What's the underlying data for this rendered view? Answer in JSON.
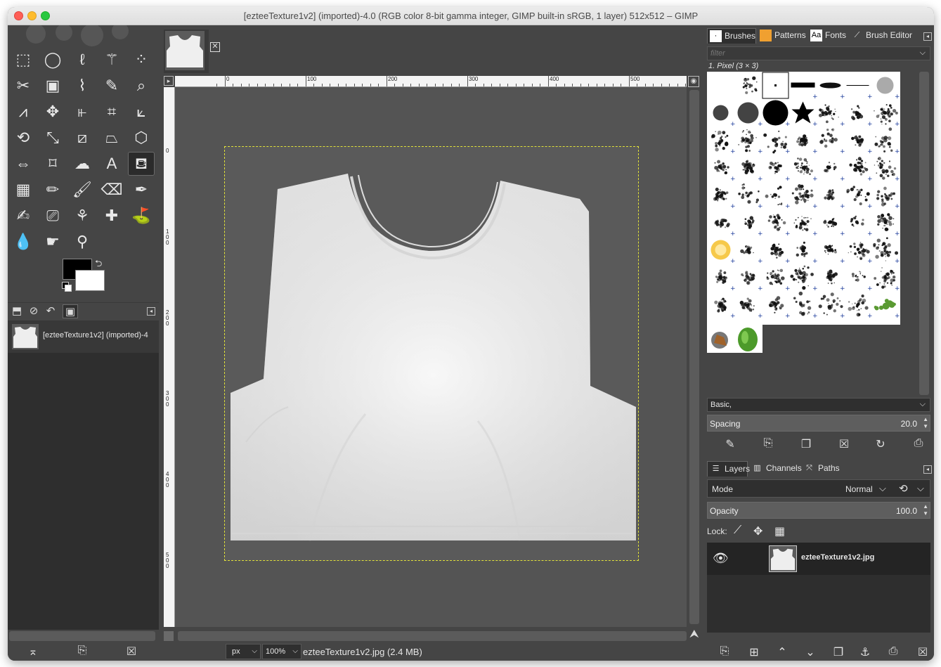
{
  "window": {
    "title": "[ezteeTexture1v2] (imported)-4.0 (RGB color 8-bit gamma integer, GIMP built-in sRGB, 1 layer) 512x512 – GIMP"
  },
  "toolbox": {
    "tools": [
      {
        "name": "rect-select-icon",
        "glyph": "⬚"
      },
      {
        "name": "ellipse-select-icon",
        "glyph": "◯"
      },
      {
        "name": "free-select-icon",
        "glyph": "ℓ"
      },
      {
        "name": "fuzzy-select-icon",
        "glyph": "⚚"
      },
      {
        "name": "select-by-color-icon",
        "glyph": "⁘"
      },
      {
        "name": "scissors-icon",
        "glyph": "✂"
      },
      {
        "name": "foreground-select-icon",
        "glyph": "▣"
      },
      {
        "name": "paths-tool-icon",
        "glyph": "⌇"
      },
      {
        "name": "color-picker-icon",
        "glyph": "✎"
      },
      {
        "name": "zoom-icon",
        "glyph": "⌕"
      },
      {
        "name": "measure-icon",
        "glyph": "⩘"
      },
      {
        "name": "move-icon",
        "glyph": "✥"
      },
      {
        "name": "align-icon",
        "glyph": "⫦"
      },
      {
        "name": "crop-icon",
        "glyph": "⌗"
      },
      {
        "name": "unified-transform-icon",
        "glyph": "⟀"
      },
      {
        "name": "rotate-icon",
        "glyph": "⟲"
      },
      {
        "name": "scale-icon",
        "glyph": "⤡"
      },
      {
        "name": "shear-icon",
        "glyph": "⧄"
      },
      {
        "name": "perspective-icon",
        "glyph": "⏢"
      },
      {
        "name": "3d-transform-icon",
        "glyph": "⬡"
      },
      {
        "name": "flip-icon",
        "glyph": "⇔"
      },
      {
        "name": "cage-transform-icon",
        "glyph": "⌑"
      },
      {
        "name": "warp-transform-icon",
        "glyph": "☁"
      },
      {
        "name": "text-tool-icon",
        "glyph": "A"
      },
      {
        "name": "bucket-fill-icon",
        "glyph": "⛾"
      },
      {
        "name": "gradient-icon",
        "glyph": "▦"
      },
      {
        "name": "pencil-icon",
        "glyph": "✏"
      },
      {
        "name": "paintbrush-icon",
        "glyph": "🖌"
      },
      {
        "name": "eraser-icon",
        "glyph": "⌫"
      },
      {
        "name": "airbrush-icon",
        "glyph": "✒"
      },
      {
        "name": "ink-icon",
        "glyph": "✍"
      },
      {
        "name": "mypaint-brush-icon",
        "glyph": "⎚"
      },
      {
        "name": "clone-icon",
        "glyph": "⚘"
      },
      {
        "name": "heal-icon",
        "glyph": "✚"
      },
      {
        "name": "perspective-clone-icon",
        "glyph": "⛳"
      },
      {
        "name": "blur-icon",
        "glyph": "💧"
      },
      {
        "name": "smudge-icon",
        "glyph": "☛"
      },
      {
        "name": "dodge-burn-icon",
        "glyph": "⚲"
      }
    ],
    "active_tool_index": 24
  },
  "left_panel": {
    "tabs": [
      "device-status-icon",
      "tool-options-icon",
      "undo-history-icon",
      "images-icon"
    ],
    "active_tab": 3,
    "images": [
      {
        "label": "[ezteeTexture1v2] (imported)-4"
      }
    ]
  },
  "canvas": {
    "ruler_labels": [
      "0",
      "100",
      "200",
      "300",
      "400",
      "500"
    ],
    "vruler_labels": [
      "0",
      "100",
      "200",
      "300",
      "400",
      "500"
    ]
  },
  "statusbar": {
    "unit": "px",
    "zoom": "100%",
    "file_info": "ezteeTexture1v2.jpg (2.4 MB)"
  },
  "brushes_panel": {
    "tabs": [
      "Brushes",
      "Patterns",
      "Fonts",
      "Brush Editor"
    ],
    "filter_placeholder": "filter",
    "selected_brush": "1. Pixel (3 × 3)",
    "tag": "Basic,",
    "spacing_label": "Spacing",
    "spacing_value": "20.0"
  },
  "layers_panel": {
    "tabs": [
      "Layers",
      "Channels",
      "Paths"
    ],
    "mode_label": "Mode",
    "mode_value": "Normal",
    "opacity_label": "Opacity",
    "opacity_value": "100.0",
    "lock_label": "Lock:",
    "layers": [
      {
        "name": "ezteeTexture1v2.jpg",
        "visible": true
      }
    ]
  },
  "colors": {
    "foreground": "#000000",
    "background": "#ffffff",
    "selection_outline": "#e2e23a"
  }
}
